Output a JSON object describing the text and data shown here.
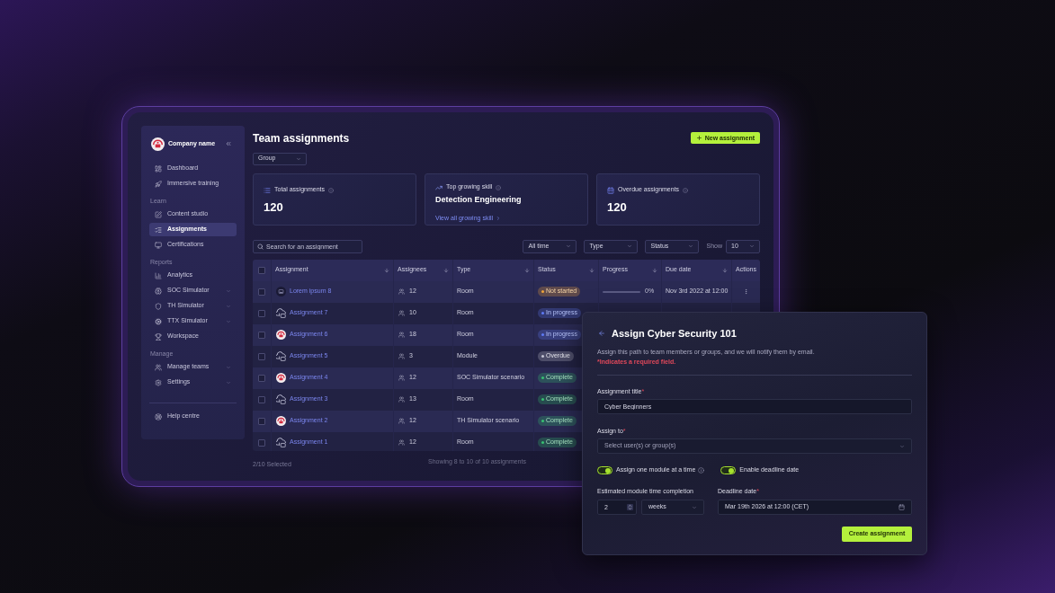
{
  "sidebar": {
    "company_name": "Company name",
    "sections": [
      {
        "items": [
          {
            "label": "Dashboard",
            "selected": false,
            "expandable": false
          },
          {
            "label": "Immersive training",
            "selected": false,
            "expandable": false
          }
        ]
      },
      {
        "heading": "Learn",
        "items": [
          {
            "label": "Content studio",
            "selected": false,
            "expandable": false
          },
          {
            "label": "Assignments",
            "selected": true,
            "expandable": false
          },
          {
            "label": "Certifications",
            "selected": false,
            "expandable": false
          }
        ]
      },
      {
        "heading": "Reports",
        "items": [
          {
            "label": "Analytics",
            "selected": false,
            "expandable": false
          },
          {
            "label": "SOC Simulator",
            "selected": false,
            "expandable": true
          },
          {
            "label": "TH Simulator",
            "selected": false,
            "expandable": true
          },
          {
            "label": "TTX Simulator",
            "selected": false,
            "expandable": true
          },
          {
            "label": "Workspace",
            "selected": false,
            "expandable": false
          }
        ]
      },
      {
        "heading": "Manage",
        "items": [
          {
            "label": "Manage teams",
            "selected": false,
            "expandable": true
          },
          {
            "label": "Settings",
            "selected": false,
            "expandable": true
          }
        ]
      }
    ],
    "footer_items": [
      {
        "label": "Help centre",
        "selected": false,
        "expandable": false
      }
    ]
  },
  "header": {
    "title": "Team assignments",
    "new_button": "New assignment",
    "group_filter": "Group"
  },
  "stats": [
    {
      "kind": "count",
      "label": "Total assignments",
      "info": true,
      "value": "120"
    },
    {
      "kind": "skill",
      "label": "Top growing skill",
      "info": true,
      "value": "Detection Engineering",
      "link": "View all growing skill"
    },
    {
      "kind": "count",
      "label": "Overdue assignments",
      "info": true,
      "value": "120"
    }
  ],
  "filters": {
    "search": {
      "placeholder": "Search for an assignment"
    },
    "dropdowns": [
      "All time",
      "Type",
      "Status"
    ],
    "show_label": "Show",
    "show_value": "10"
  },
  "table": {
    "all_checked": false,
    "columns": [
      {
        "label": "Assignment",
        "sortable": true
      },
      {
        "label": "Assignees",
        "sortable": true
      },
      {
        "label": "Type",
        "sortable": true
      },
      {
        "label": "Status",
        "sortable": true
      },
      {
        "label": "Progress",
        "sortable": true
      },
      {
        "label": "Due date",
        "sortable": true
      },
      {
        "label": "Actions",
        "sortable": false
      }
    ],
    "rows": [
      {
        "kind": "image",
        "checked": false,
        "name": "Lorem ipsum 8",
        "assignees": "12",
        "type": "Room",
        "status": {
          "label": "Not started",
          "color": "#f0a43a"
        },
        "progress": {
          "level": 0,
          "reading": "0%"
        },
        "due_date": "Nov 3rd 2022 at 12:00",
        "actions_menu": true
      },
      {
        "kind": "cloud",
        "checked": false,
        "name": "Assignment 7",
        "assignees": "10",
        "type": "Room",
        "status": {
          "label": "In progress",
          "color": "#5f7bf5"
        },
        "actions_menu": false
      },
      {
        "kind": "emblem",
        "checked": false,
        "name": "Assignment 6",
        "assignees": "18",
        "type": "Room",
        "status": {
          "label": "In progress",
          "color": "#5f7bf5"
        },
        "actions_menu": false
      },
      {
        "kind": "cloud",
        "checked": false,
        "name": "Assignment 5",
        "assignees": "3",
        "type": "Module",
        "status": {
          "label": "Overdue",
          "color": "#c4c4d4"
        },
        "actions_menu": false
      },
      {
        "kind": "emblem",
        "checked": false,
        "name": "Assignment 4",
        "assignees": "12",
        "type": "SOC Simulator scenario",
        "status": {
          "label": "Complete",
          "color": "#38c172"
        },
        "actions_menu": false
      },
      {
        "kind": "cloud",
        "checked": false,
        "name": "Assignment 3",
        "assignees": "13",
        "type": "Room",
        "status": {
          "label": "Complete",
          "color": "#38c172"
        },
        "actions_menu": false
      },
      {
        "kind": "emblem",
        "checked": false,
        "name": "Assignment 2",
        "assignees": "12",
        "type": "TH Simulator scenario",
        "status": {
          "label": "Complete",
          "color": "#38c172"
        },
        "actions_menu": false
      },
      {
        "kind": "cloud",
        "checked": false,
        "name": "Assignment 1",
        "assignees": "12",
        "type": "Room",
        "status": {
          "label": "Complete",
          "color": "#38c172"
        },
        "actions_menu": false
      }
    ]
  },
  "table_footer": {
    "selected": "2/10 Selected",
    "showing": "Showing 8 to 10 of 10 assignments"
  },
  "modal": {
    "title": "Assign Cyber Security 101",
    "description": "Assign this path to team members or groups, and we will notify them by email.",
    "required_note": "*Indicates a required field.",
    "title_field": {
      "label": "Assignment title",
      "required_mark": "*",
      "value": "Cyber Beginners"
    },
    "assign_field": {
      "label": "Assign to",
      "required_mark": "*",
      "placeholder": "Select user(s) or group(s)"
    },
    "toggles": [
      {
        "label": "Assign one module at a time",
        "on": true,
        "info": true
      },
      {
        "label": "Enable deadline date",
        "on": true,
        "info": false
      }
    ],
    "estimate": {
      "label": "Estimated module time completion",
      "value": "2",
      "unit": "weeks"
    },
    "deadline": {
      "label": "Deadline date",
      "required_mark": "*",
      "value": "Mar 19th 2026 at 12:00 (CET)"
    },
    "submit": "Create assignment"
  }
}
